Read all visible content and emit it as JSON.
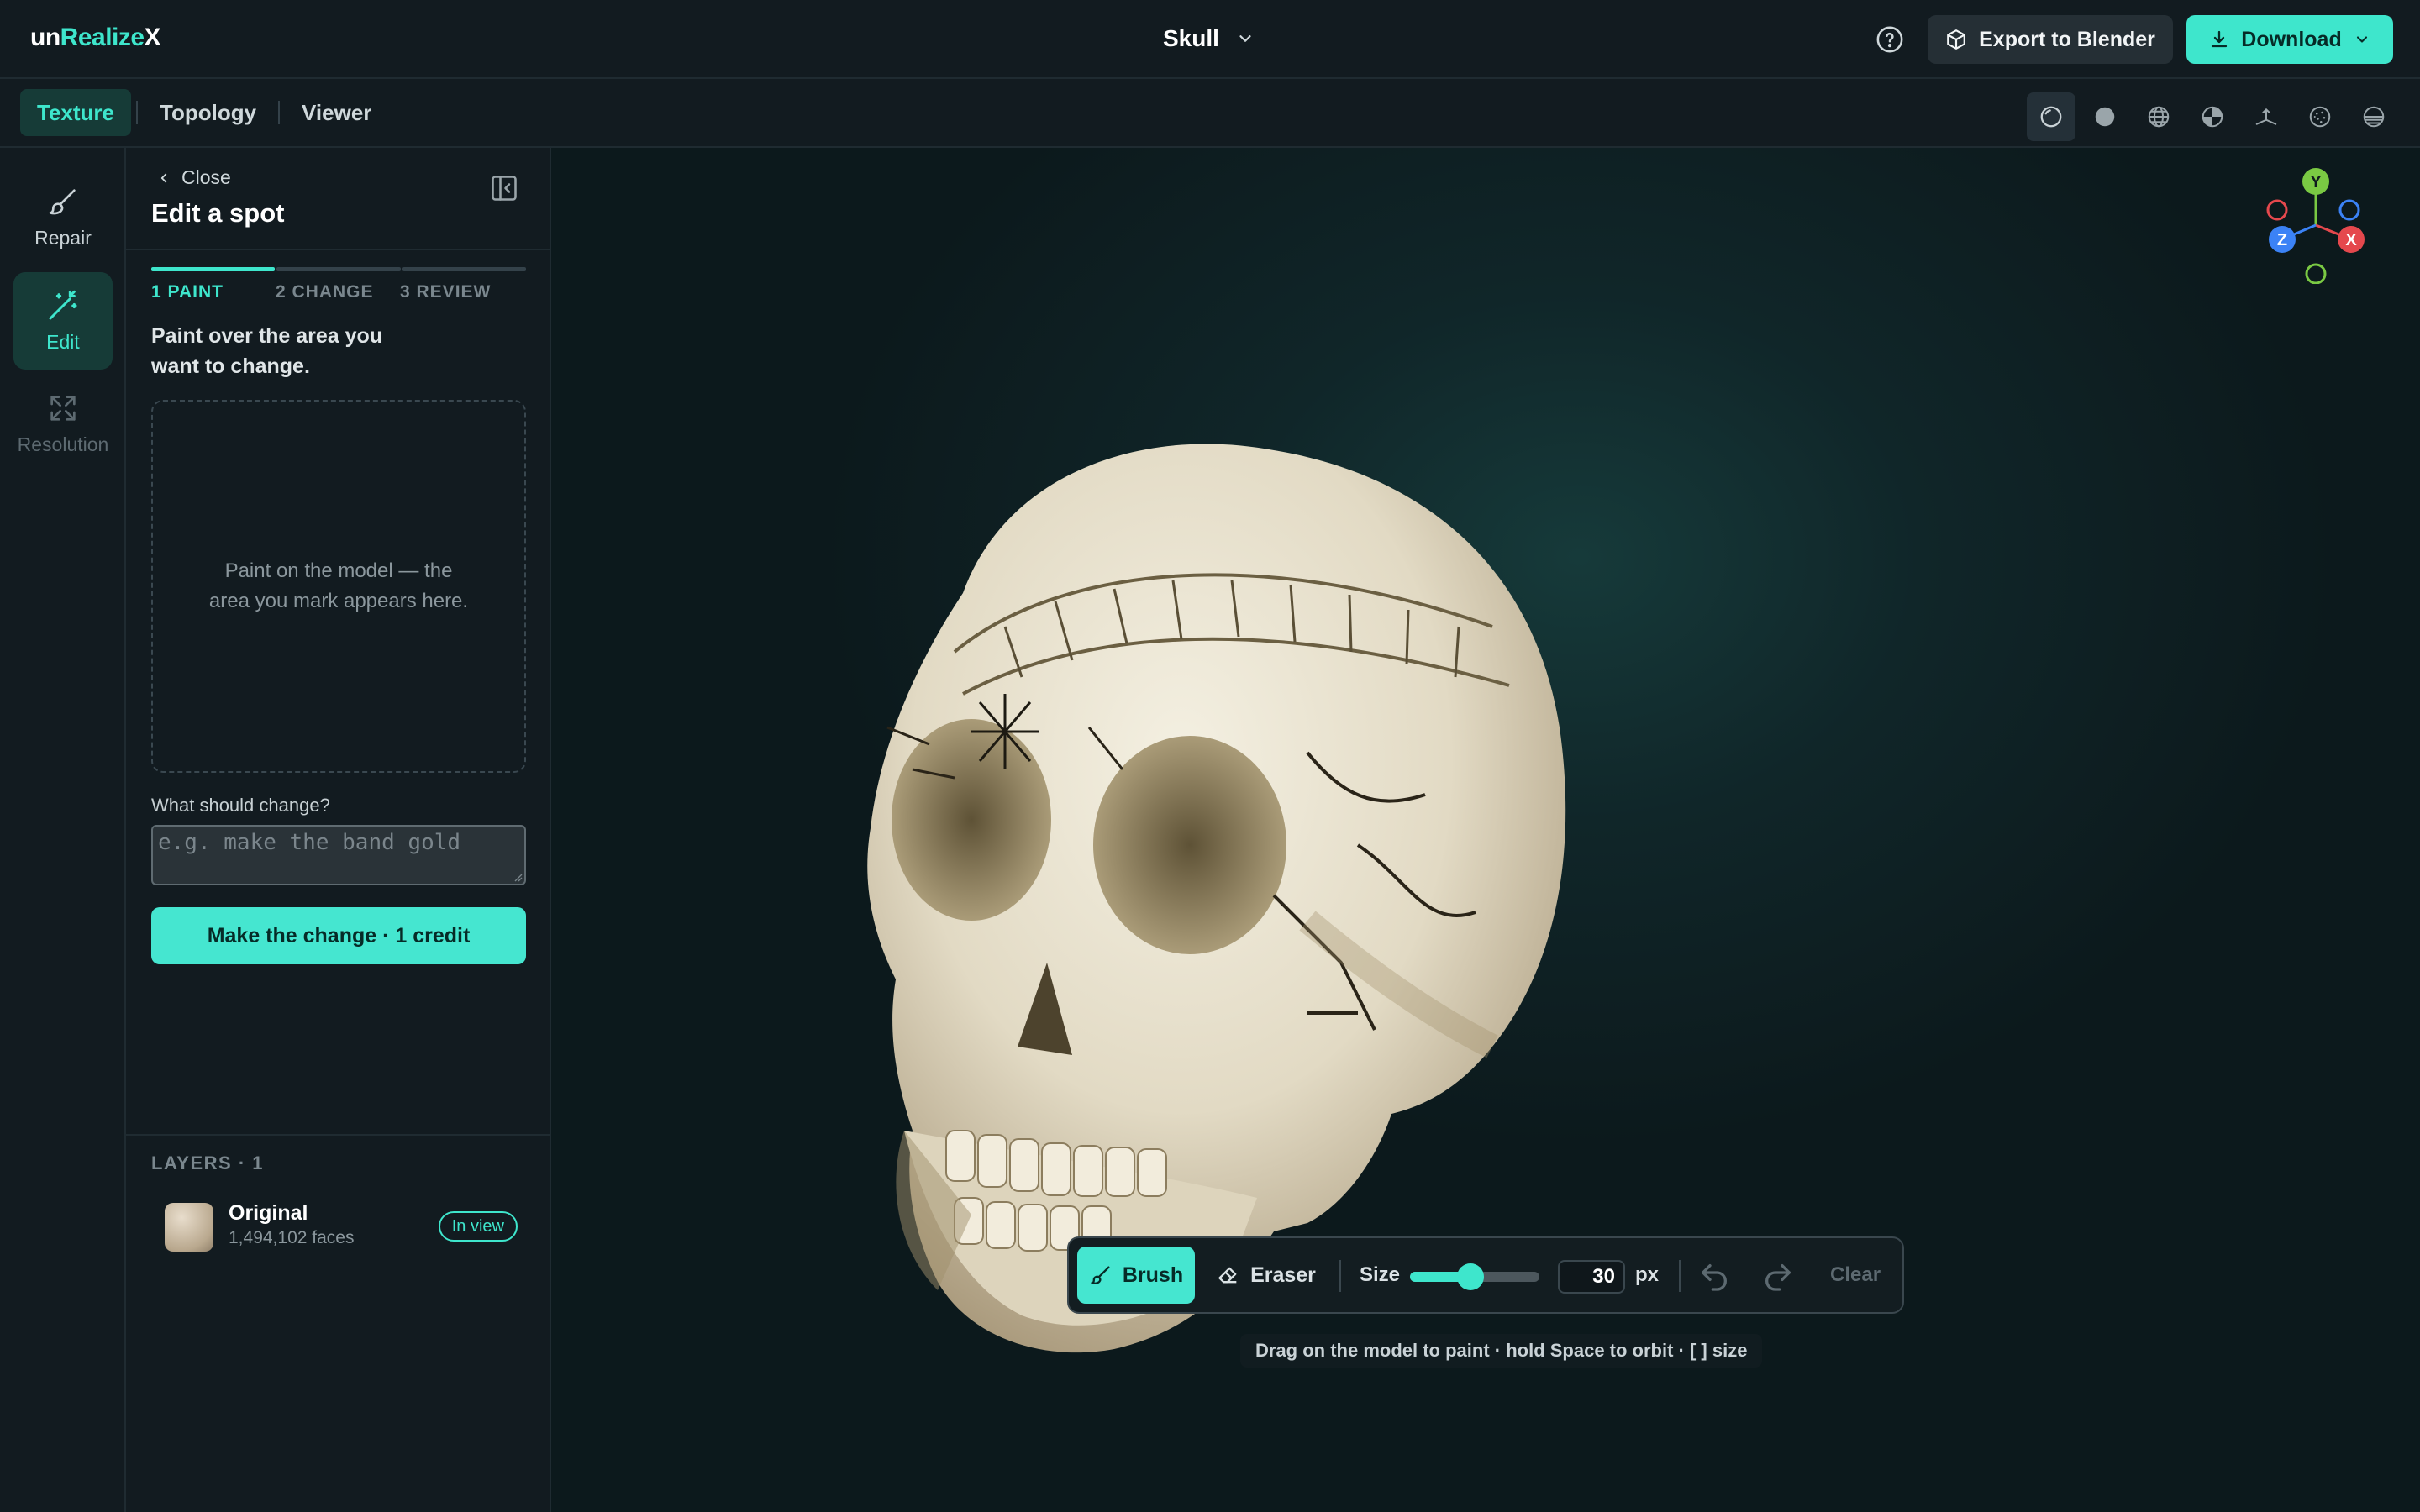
{
  "app": {
    "logo_prefix": "un",
    "logo_accent": "Realize",
    "logo_suffix": "X",
    "model_title": "Skull"
  },
  "header": {
    "help_icon": "help-circle-icon",
    "export_label": "Export to Blender",
    "download_label": "Download"
  },
  "tabs": [
    {
      "label": "Texture",
      "active": true
    },
    {
      "label": "Topology",
      "active": false
    },
    {
      "label": "Viewer",
      "active": false
    }
  ],
  "view_modes": [
    "matcap-icon",
    "solid-icon",
    "wireframe-icon",
    "uv-checker-icon",
    "normals-icon",
    "noise-icon",
    "environment-icon"
  ],
  "rail": {
    "items": [
      {
        "label": "Repair",
        "icon": "brush-icon",
        "state": "normal"
      },
      {
        "label": "Edit",
        "icon": "magic-wand-icon",
        "state": "active"
      },
      {
        "label": "Resolution",
        "icon": "expand-icon",
        "state": "disabled"
      }
    ]
  },
  "panel": {
    "close_label": "Close",
    "title": "Edit a spot",
    "steps": [
      "1 PAINT",
      "2 CHANGE",
      "3 REVIEW"
    ],
    "current_step": 1,
    "instruction": "Paint over the area you want to change.",
    "paint_placeholder": "Paint on the model — the area you mark appears here.",
    "field_label": "What should change?",
    "field_placeholder": "e.g. make the band gold",
    "field_value": "",
    "submit_label": "Make the change · 1 credit"
  },
  "layers": {
    "heading": "LAYERS · 1",
    "items": [
      {
        "name": "Original",
        "faces": "1,494,102 faces",
        "badge": "In view"
      }
    ]
  },
  "toolbar": {
    "brush_label": "Brush",
    "eraser_label": "Eraser",
    "size_label": "Size",
    "size_value": "30",
    "size_fraction": 0.47,
    "unit": "px",
    "clear_label": "Clear"
  },
  "hint": "Drag on the model to paint · hold Space to orbit · [ ] size",
  "gizmo": {
    "y": "Y",
    "x": "X",
    "z": "Z"
  },
  "colors": {
    "accent": "#3ee6cc",
    "axis_x": "#e5484d",
    "axis_y": "#7ac943",
    "axis_z": "#3b82f6"
  }
}
